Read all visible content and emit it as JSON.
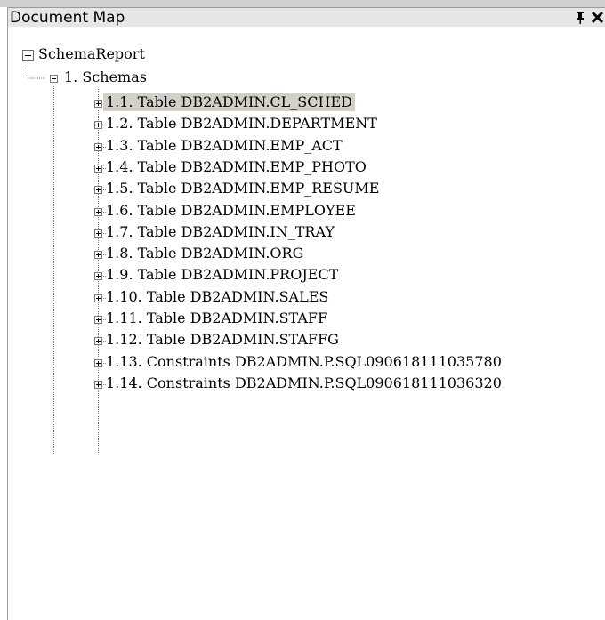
{
  "panel": {
    "title": "Document Map",
    "pin_icon": "pin-icon",
    "close_icon": "close-icon"
  },
  "tree": {
    "root": {
      "label": "SchemaReport",
      "expanded": true
    },
    "schemas": {
      "label": "1. Schemas",
      "expanded": true
    },
    "items": [
      {
        "label": "1.1. Table DB2ADMIN.CL_SCHED",
        "selected": true
      },
      {
        "label": "1.2. Table DB2ADMIN.DEPARTMENT"
      },
      {
        "label": "1.3. Table DB2ADMIN.EMP_ACT"
      },
      {
        "label": "1.4. Table DB2ADMIN.EMP_PHOTO"
      },
      {
        "label": "1.5. Table DB2ADMIN.EMP_RESUME"
      },
      {
        "label": "1.6. Table DB2ADMIN.EMPLOYEE"
      },
      {
        "label": "1.7. Table DB2ADMIN.IN_TRAY"
      },
      {
        "label": "1.8. Table DB2ADMIN.ORG"
      },
      {
        "label": "1.9. Table DB2ADMIN.PROJECT"
      },
      {
        "label": "1.10. Table DB2ADMIN.SALES"
      },
      {
        "label": "1.11. Table DB2ADMIN.STAFF"
      },
      {
        "label": "1.12. Table DB2ADMIN.STAFFG"
      },
      {
        "label": "1.13. Constraints DB2ADMIN.P.SQL090618111035780"
      },
      {
        "label": "1.14. Constraints DB2ADMIN.P.SQL090618111036320"
      }
    ]
  }
}
